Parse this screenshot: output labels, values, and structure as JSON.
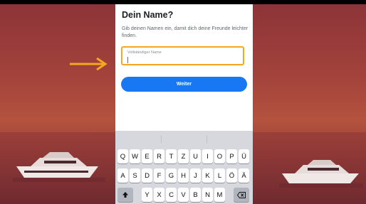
{
  "screen": {
    "title": "Dein Name?",
    "subtitle": "Gib deinen Namen ein, damit dich deine Freunde leichter finden.",
    "name_field": {
      "label": "Vollständiger Name",
      "value": ""
    },
    "next_button": "Weiter"
  },
  "keyboard": {
    "row1": [
      "Q",
      "W",
      "E",
      "R",
      "T",
      "Z",
      "U",
      "I",
      "O",
      "P",
      "Ü"
    ],
    "row2": [
      "A",
      "S",
      "D",
      "F",
      "G",
      "H",
      "J",
      "K",
      "L",
      "Ö",
      "Ä"
    ],
    "row3": [
      "Y",
      "X",
      "C",
      "V",
      "B",
      "N",
      "M"
    ],
    "shift_icon": "shift-arrow-icon",
    "delete_icon": "backspace-icon"
  },
  "colors": {
    "accent_blue": "#1877f2",
    "highlight_orange": "#f5a623",
    "background_red": "#a2423b"
  }
}
